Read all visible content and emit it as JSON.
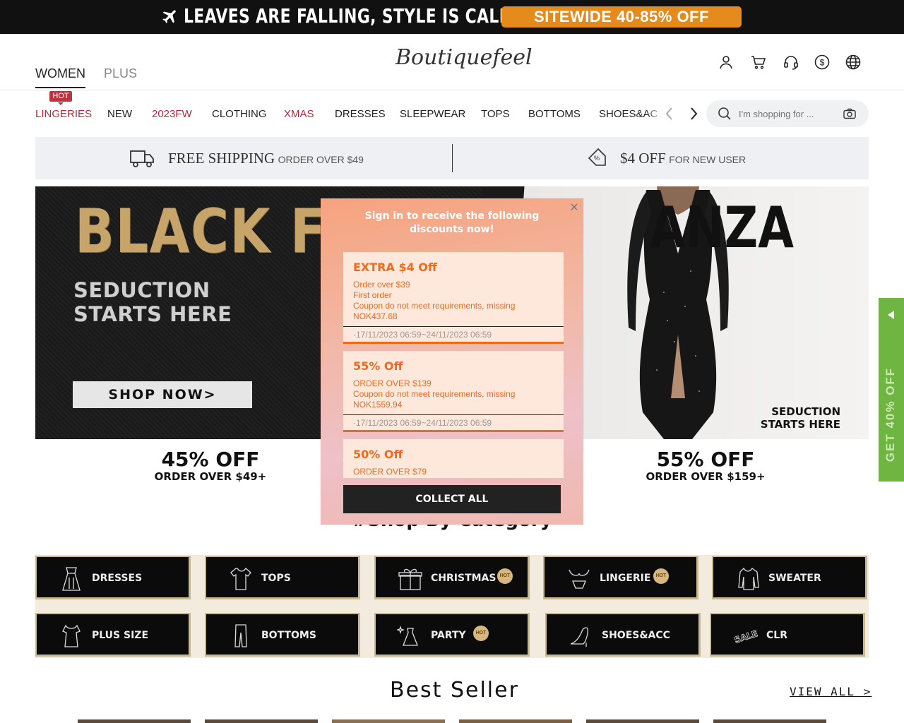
{
  "announcement": {
    "slogan": "LEAVES ARE FALLING, STYLE IS CALLING!",
    "promo": "SITEWIDE 40-85% OFF"
  },
  "header": {
    "tabs": [
      {
        "label": "WOMEN",
        "active": true
      },
      {
        "label": "PLUS",
        "active": false
      }
    ],
    "logo": "Boutiquefeel",
    "icons": [
      "user-icon",
      "cart-icon",
      "headset-icon",
      "currency-icon",
      "globe-icon"
    ]
  },
  "nav": {
    "hot_badge": "HOT",
    "items": [
      {
        "label": "LINGERIES",
        "color": "#b72a3a"
      },
      {
        "label": "NEW",
        "color": "#222222"
      },
      {
        "label": "2023FW",
        "color": "#b72a3a"
      },
      {
        "label": "CLOTHING",
        "color": "#222222"
      },
      {
        "label": "XMAS",
        "color": "#b72a3a"
      },
      {
        "label": "DRESSES",
        "color": "#222222"
      },
      {
        "label": "SLEEPWEAR",
        "color": "#222222"
      },
      {
        "label": "TOPS",
        "color": "#222222"
      },
      {
        "label": "BOTTOMS",
        "color": "#222222"
      },
      {
        "label": "SHOES&ACC",
        "color": "#222222"
      }
    ],
    "search_placeholder": "I'm shopping for ..."
  },
  "shipping": {
    "left_big": "FREE SHIPPING",
    "left_small": "ORDER OVER $49",
    "right_big": "$4 OFF",
    "right_small": "FOR NEW USER"
  },
  "banner": {
    "headline_left": "BLACK FRI",
    "headline_right": "ANZA",
    "seduction_line1": "SEDUCTION",
    "seduction_line2": "STARTS HERE",
    "shop_now": "SHOP NOW>",
    "right_seduction_line1": "SEDUCTION",
    "right_seduction_line2": "STARTS HERE",
    "offers": [
      {
        "pct": "45% OFF",
        "order": "ORDER OVER $49+"
      },
      {
        "pct": "55% OFF",
        "order": "ORDER OVER $159+"
      }
    ]
  },
  "category": {
    "title": "#Shop By Category",
    "items": [
      {
        "label": "DRESSES",
        "hot": false
      },
      {
        "label": "TOPS",
        "hot": false
      },
      {
        "label": "CHRISTMAS",
        "hot": true
      },
      {
        "label": "LINGERIE",
        "hot": true
      },
      {
        "label": "SWEATER",
        "hot": false
      },
      {
        "label": "PLUS SIZE",
        "hot": false
      },
      {
        "label": "BOTTOMS",
        "hot": false
      },
      {
        "label": "PARTY",
        "hot": true
      },
      {
        "label": "SHOES&ACC",
        "hot": false
      },
      {
        "label": "CLR",
        "hot": false
      }
    ],
    "hot_label": "HOT",
    "sale_label": "SALE"
  },
  "best_seller": {
    "title": "Best Seller",
    "view_all": "VIEW ALL >"
  },
  "side_tab": {
    "label": "GET 40% OFF"
  },
  "modal": {
    "title": "Sign in to receive the following discounts now!",
    "coupons": [
      {
        "title": "EXTRA $4 Off",
        "lines": [
          "Order over $39",
          "First order",
          "Coupon do not meet requirements, missing NOK437.68"
        ],
        "date": "·17/11/2023 06:59~24/11/2023 06:59"
      },
      {
        "title": "55% Off",
        "lines": [
          "ORDER OVER $139",
          "Coupon do not meet requirements, missing NOK1559.94"
        ],
        "date": "·17/11/2023 06:59~24/11/2023 06:59"
      },
      {
        "title": "50% Off",
        "lines": [
          "ORDER OVER $79"
        ],
        "date": ""
      }
    ],
    "collect_all": "COLLECT ALL"
  }
}
